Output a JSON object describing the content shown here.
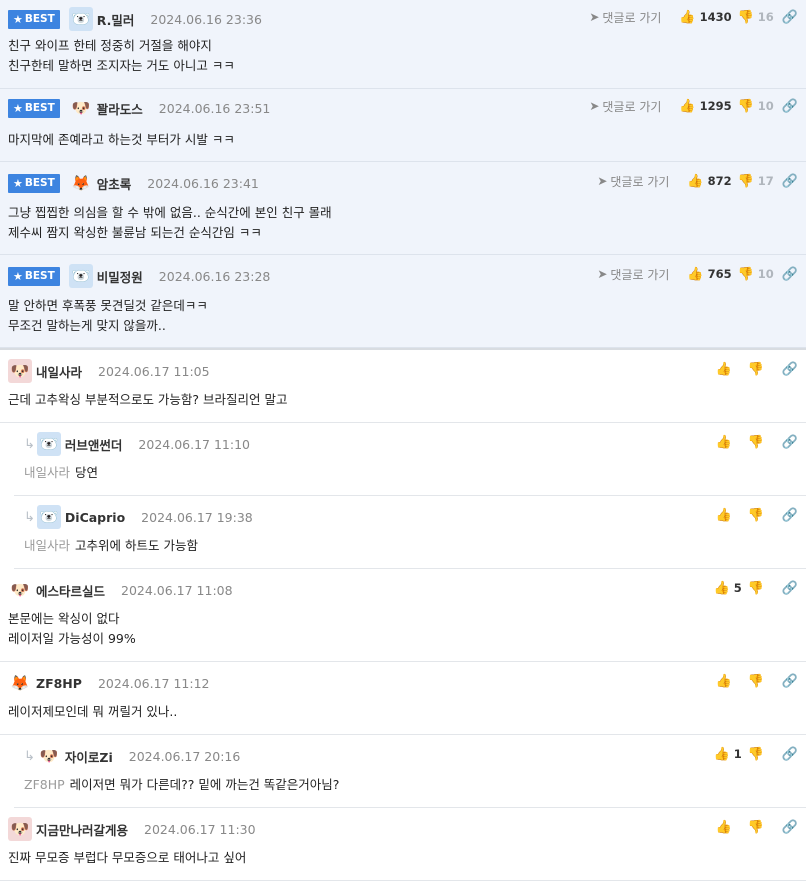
{
  "best_badge": "BEST",
  "goto_label": "댓글로 가기",
  "best_comments": [
    {
      "nick": "R.밀러",
      "date": "2024.06.16 23:36",
      "likes": "1430",
      "dislikes": "16",
      "avatar": "blue",
      "lines": [
        "친구 와이프 한테 정중히 거절을 해야지",
        "친구한테 말하면 조지자는 거도 아니고 ㅋㅋ"
      ]
    },
    {
      "nick": "꽐라도스",
      "date": "2024.06.16 23:51",
      "likes": "1295",
      "dislikes": "10",
      "avatar": "dog",
      "lines": [
        "마지막에 존예라고 하는것 부터가 시발 ㅋㅋ"
      ]
    },
    {
      "nick": "암초록",
      "date": "2024.06.16 23:41",
      "likes": "872",
      "dislikes": "17",
      "avatar": "fox",
      "lines": [
        "그냥 찝찝한 의심을 할 수 밖에 없음.. 순식간에 본인 친구 몰래",
        "제수씨 짬지 왁싱한 불륜남 되는건 순식간임 ㅋㅋ"
      ]
    },
    {
      "nick": "비밀정원",
      "date": "2024.06.16 23:28",
      "likes": "765",
      "dislikes": "10",
      "avatar": "blue",
      "lines": [
        "말 안하면 후폭풍 못견딜것 같은데ㅋㅋ",
        "무조건 말하는게 맞지 않을까.."
      ]
    }
  ],
  "comments": [
    {
      "nick": "내일사라",
      "date": "2024.06.17 11:05",
      "likes": "",
      "avatar": "red",
      "reply": false,
      "mention": "",
      "lines": [
        "근데 고추왁싱 부분적으로도 가능함? 브라질리언 말고"
      ]
    },
    {
      "nick": "러브앤썬더",
      "date": "2024.06.17 11:10",
      "likes": "",
      "avatar": "blue",
      "reply": true,
      "mention": "내일사라",
      "lines": [
        "당연"
      ]
    },
    {
      "nick": "DiCaprio",
      "date": "2024.06.17 19:38",
      "likes": "",
      "avatar": "blue",
      "reply": true,
      "mention": "내일사라",
      "lines": [
        "고추위에 하트도 가능함"
      ]
    },
    {
      "nick": "에스타르실드",
      "date": "2024.06.17 11:08",
      "likes": "5",
      "avatar": "dog",
      "reply": false,
      "mention": "",
      "lines": [
        "본문에는 왁싱이 없다",
        "레이저일 가능성이 99%"
      ]
    },
    {
      "nick": "ZF8HP",
      "date": "2024.06.17 11:12",
      "likes": "",
      "avatar": "fox",
      "reply": false,
      "mention": "",
      "lines": [
        "레이저제모인데 뭐 꺼릴거 있나.."
      ]
    },
    {
      "nick": "자이로Zi",
      "date": "2024.06.17 20:16",
      "likes": "1",
      "avatar": "dog",
      "reply": true,
      "mention": "ZF8HP",
      "lines": [
        "레이저면 뭐가 다른데?? 밑에 까는건 똑같은거아님?"
      ]
    },
    {
      "nick": "지금만나러갈게용",
      "date": "2024.06.17 11:30",
      "likes": "",
      "avatar": "red",
      "reply": false,
      "mention": "",
      "lines": [
        "진짜 무모증 부럽다 무모증으로 태어나고 싶어"
      ]
    }
  ],
  "icons": {
    "like": "thumbs-up-icon",
    "dislike": "thumbs-down-icon",
    "link": "link-icon",
    "goto": "arrow-icon",
    "star": "star-icon",
    "reply": "reply-arrow-icon"
  }
}
